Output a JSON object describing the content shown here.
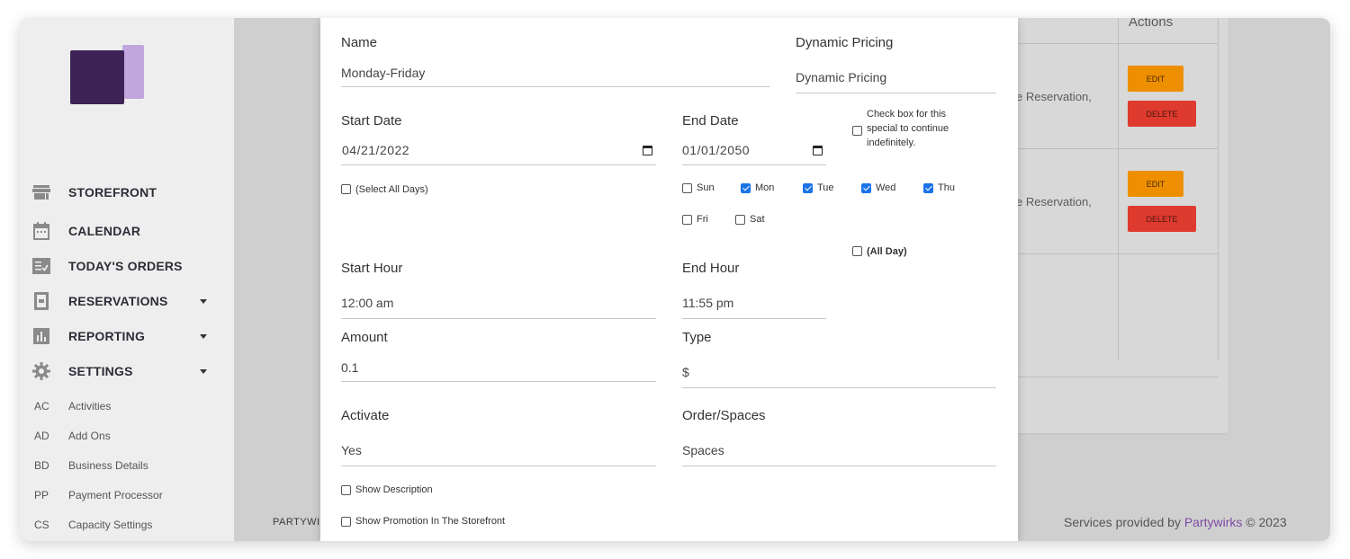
{
  "sidebar": {
    "nav": [
      {
        "label": "STOREFRONT",
        "icon": "store-icon"
      },
      {
        "label": "CALENDAR",
        "icon": "calendar-icon"
      },
      {
        "label": "TODAY'S ORDERS",
        "icon": "checklist-icon"
      },
      {
        "label": "RESERVATIONS",
        "icon": "clipboard-icon"
      },
      {
        "label": "REPORTING",
        "icon": "bar-chart-icon"
      },
      {
        "label": "SETTINGS",
        "icon": "gear-icon"
      }
    ],
    "sub_items": [
      {
        "abbr": "AC",
        "label": "Activities"
      },
      {
        "abbr": "AD",
        "label": "Add Ons"
      },
      {
        "abbr": "BD",
        "label": "Business Details"
      },
      {
        "abbr": "PP",
        "label": "Payment Processor"
      },
      {
        "abbr": "CS",
        "label": "Capacity Settings"
      }
    ]
  },
  "background": {
    "actions_header": "Actions",
    "rows": [
      {
        "text": "e Reservation,",
        "edit": "EDIT",
        "delete": "DELETE"
      },
      {
        "text": "e Reservation,",
        "edit": "EDIT",
        "delete": "DELETE"
      }
    ],
    "footer_left": "PARTYWIR",
    "footer_right_prefix": "Services provided by ",
    "footer_right_link": "Partywirks",
    "footer_right_suffix": " © 2023"
  },
  "form": {
    "name_label": "Name",
    "name_value": "Monday-Friday",
    "dynamic_label": "Dynamic Pricing",
    "dynamic_value": "Dynamic Pricing",
    "start_date_label": "Start Date",
    "start_date_value": "04/21/2022",
    "end_date_label": "End Date",
    "end_date_value": "01/01/2050",
    "indefinite_note": "Check box for this special to continue indefinitely.",
    "select_all_days": "(Select All Days)",
    "days": [
      {
        "label": "Sun",
        "checked": false
      },
      {
        "label": "Mon",
        "checked": true
      },
      {
        "label": "Tue",
        "checked": true
      },
      {
        "label": "Wed",
        "checked": true
      },
      {
        "label": "Thu",
        "checked": true
      },
      {
        "label": "Fri",
        "checked": false
      },
      {
        "label": "Sat",
        "checked": false
      }
    ],
    "all_day": "(All Day)",
    "start_hour_label": "Start Hour",
    "start_hour_value": "12:00 am",
    "end_hour_label": "End Hour",
    "end_hour_value": "11:55 pm",
    "amount_label": "Amount",
    "amount_value": "0.1",
    "type_label": "Type",
    "type_value": "$",
    "activate_label": "Activate",
    "activate_value": "Yes",
    "order_spaces_label": "Order/Spaces",
    "order_spaces_value": "Spaces",
    "show_description": "Show Description",
    "show_promotion": "Show Promotion In The Storefront"
  }
}
